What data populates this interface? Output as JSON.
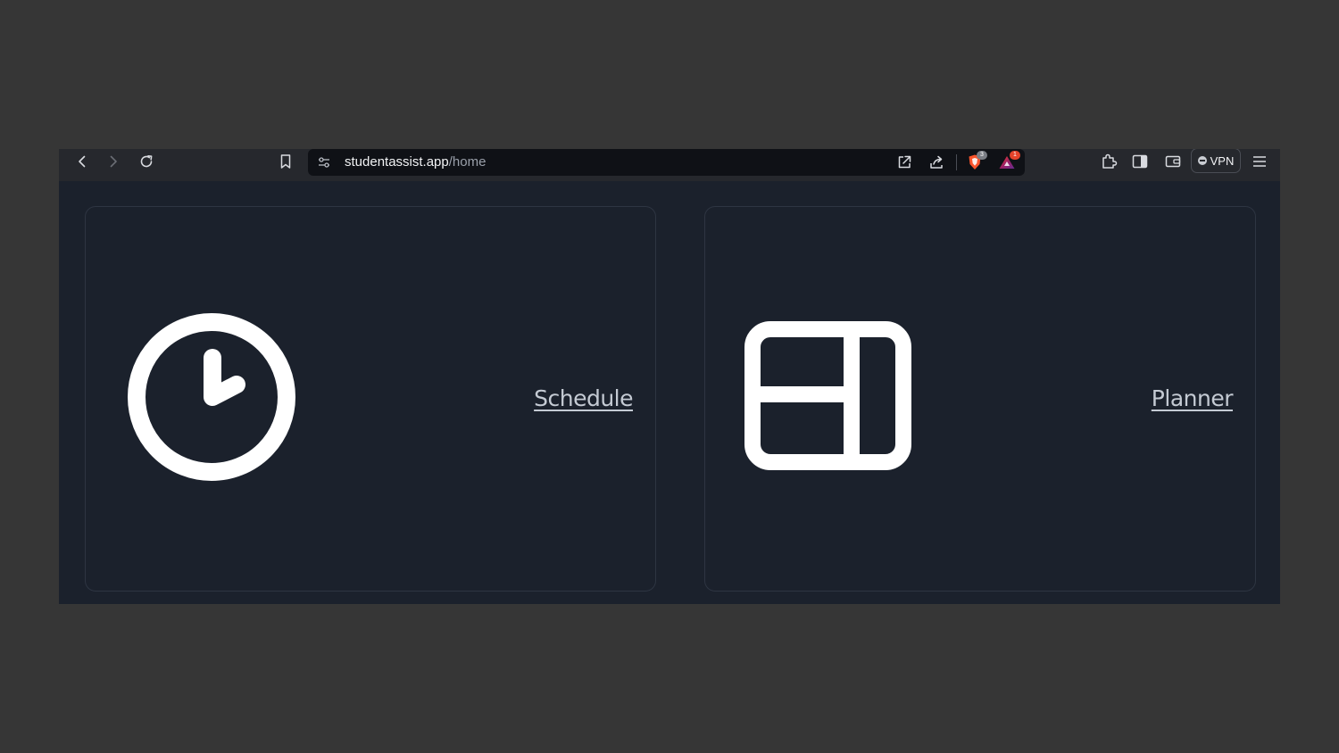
{
  "browser": {
    "url_host": "studentassist.app",
    "url_path": "/home",
    "shields_count": "3",
    "rewards_count": "1",
    "vpn_label": "VPN"
  },
  "toolbar_icons": {
    "back": "back-arrow-icon",
    "forward": "forward-arrow-icon",
    "reload": "reload-icon",
    "bookmark": "bookmark-icon",
    "site_settings": "site-settings-icon",
    "open_external": "open-external-icon",
    "share": "share-icon",
    "shields": "brave-shields-icon",
    "rewards": "brave-rewards-icon",
    "extensions": "extensions-icon",
    "sidebar": "sidebar-icon",
    "wallet": "wallet-icon",
    "menu": "hamburger-menu-icon"
  },
  "cards": [
    {
      "label": "Schedule",
      "icon": "clock-icon"
    },
    {
      "label": "Planner",
      "icon": "layout-panels-icon"
    }
  ],
  "colors": {
    "page_background": "#363636",
    "app_background": "#1b212c",
    "toolbar_background": "#26282d",
    "urlbar_background": "#0f1116",
    "card_border": "#2e3542",
    "link_color": "#c4cad3",
    "icon_color": "#ffffff",
    "shields_orange": "#fb542b",
    "badge_gray": "#7a7d84",
    "badge_red": "#e5432a"
  }
}
